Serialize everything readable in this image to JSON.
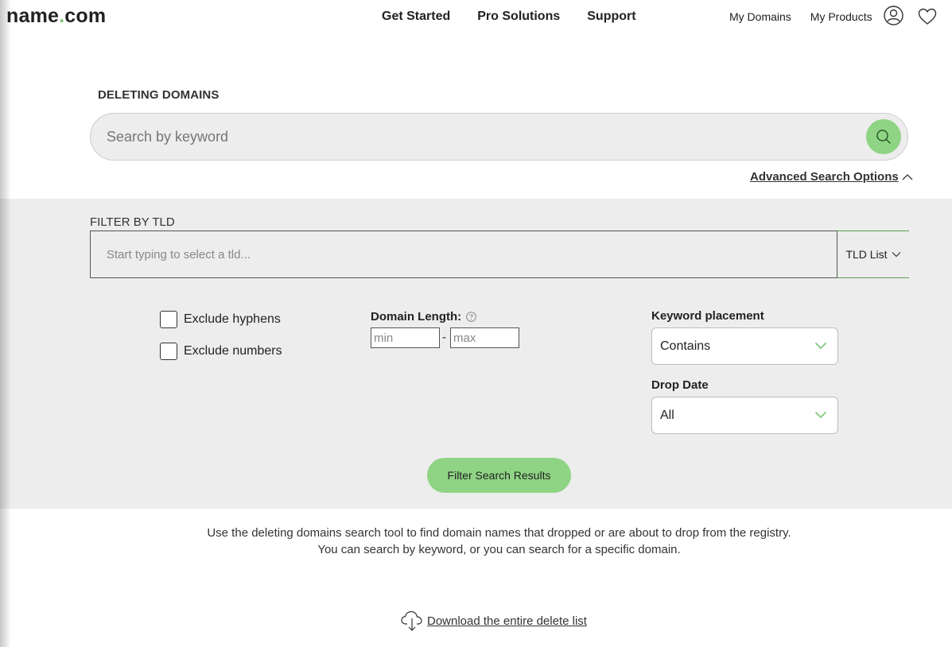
{
  "header": {
    "logo_main": "name",
    "logo_dot": ".",
    "logo_tld": "com",
    "nav": [
      "Get Started",
      "Pro Solutions",
      "Support"
    ],
    "right_links": [
      "My Domains",
      "My Products"
    ],
    "icons": [
      "user-icon",
      "heart-icon"
    ]
  },
  "search": {
    "title": "DELETING DOMAINS",
    "placeholder": "Search by keyword",
    "advanced_label": "Advanced Search Options"
  },
  "filter": {
    "tld_label": "FILTER BY TLD",
    "tld_placeholder": "Start typing to select a tld...",
    "tld_list_label": "TLD List",
    "exclude_hyphens": "Exclude hyphens",
    "exclude_numbers": "Exclude numbers",
    "length_label": "Domain Length:",
    "min_placeholder": "min",
    "max_placeholder": "max",
    "dash": "-",
    "keyword_label": "Keyword placement",
    "keyword_value": "Contains",
    "drop_label": "Drop Date",
    "drop_value": "All",
    "submit_label": "Filter Search Results"
  },
  "info": {
    "line1": "Use the deleting domains search tool to find domain names that dropped or are about to drop from the registry.",
    "line2": "You can search by keyword, or you can search for a specific domain.",
    "download_label": "Download the entire delete list"
  },
  "colors": {
    "accent_green": "#8fd484",
    "panel_gray": "#ededed"
  }
}
